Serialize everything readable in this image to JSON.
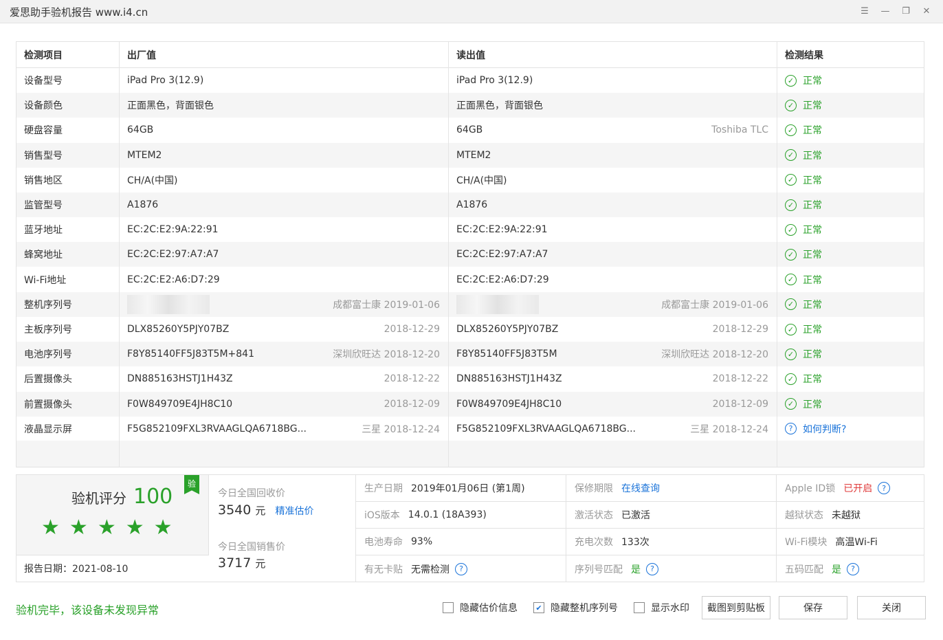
{
  "window": {
    "title": "爱思助手验机报告 www.i4.cn",
    "controls": [
      "menu-icon",
      "minimize-icon",
      "restore-icon",
      "close-icon"
    ]
  },
  "table": {
    "headers": {
      "item": "检测项目",
      "factory": "出厂值",
      "read": "读出值",
      "result": "检测结果"
    },
    "rows": [
      {
        "item": "设备型号",
        "factory": "iPad Pro 3(12.9)",
        "factory_note": "",
        "read": "iPad Pro 3(12.9)",
        "read_note": "",
        "result": "正常",
        "status": "ok"
      },
      {
        "item": "设备颜色",
        "factory": "正面黑色，背面银色",
        "factory_note": "",
        "read": "正面黑色，背面银色",
        "read_note": "",
        "result": "正常",
        "status": "ok"
      },
      {
        "item": "硬盘容量",
        "factory": "64GB",
        "factory_note": "",
        "read": "64GB",
        "read_note": "Toshiba TLC",
        "result": "正常",
        "status": "ok"
      },
      {
        "item": "销售型号",
        "factory": "MTEM2",
        "factory_note": "",
        "read": "MTEM2",
        "read_note": "",
        "result": "正常",
        "status": "ok"
      },
      {
        "item": "销售地区",
        "factory": "CH/A(中国)",
        "factory_note": "",
        "read": "CH/A(中国)",
        "read_note": "",
        "result": "正常",
        "status": "ok"
      },
      {
        "item": "监管型号",
        "factory": "A1876",
        "factory_note": "",
        "read": "A1876",
        "read_note": "",
        "result": "正常",
        "status": "ok"
      },
      {
        "item": "蓝牙地址",
        "factory": "EC:2C:E2:9A:22:91",
        "factory_note": "",
        "read": "EC:2C:E2:9A:22:91",
        "read_note": "",
        "result": "正常",
        "status": "ok"
      },
      {
        "item": "蜂窝地址",
        "factory": "EC:2C:E2:97:A7:A7",
        "factory_note": "",
        "read": "EC:2C:E2:97:A7:A7",
        "read_note": "",
        "result": "正常",
        "status": "ok"
      },
      {
        "item": "Wi-Fi地址",
        "factory": "EC:2C:E2:A6:D7:29",
        "factory_note": "",
        "read": "EC:2C:E2:A6:D7:29",
        "read_note": "",
        "result": "正常",
        "status": "ok"
      },
      {
        "item": "整机序列号",
        "factory": "",
        "factory_note": "成都富士康 2019-01-06",
        "read": "",
        "read_note": "成都富士康 2019-01-06",
        "result": "正常",
        "status": "ok",
        "hidden": true
      },
      {
        "item": "主板序列号",
        "factory": "DLX85260Y5PJY07BZ",
        "factory_note": "2018-12-29",
        "read": "DLX85260Y5PJY07BZ",
        "read_note": "2018-12-29",
        "result": "正常",
        "status": "ok"
      },
      {
        "item": "电池序列号",
        "factory": "F8Y85140FF5J83T5M+841",
        "factory_note": "深圳欣旺达 2018-12-20",
        "read": "F8Y85140FF5J83T5M",
        "read_note": "深圳欣旺达 2018-12-20",
        "result": "正常",
        "status": "ok"
      },
      {
        "item": "后置摄像头",
        "factory": "DN885163HSTJ1H43Z",
        "factory_note": "2018-12-22",
        "read": "DN885163HSTJ1H43Z",
        "read_note": "2018-12-22",
        "result": "正常",
        "status": "ok"
      },
      {
        "item": "前置摄像头",
        "factory": "F0W849709E4JH8C10",
        "factory_note": "2018-12-09",
        "read": "F0W849709E4JH8C10",
        "read_note": "2018-12-09",
        "result": "正常",
        "status": "ok"
      },
      {
        "item": "液晶显示屏",
        "factory": "F5G852109FXL3RVAAGLQA6718BG...",
        "factory_note": "三星 2018-12-24",
        "read": "F5G852109FXL3RVAAGLQA6718BG...",
        "read_note": "三星 2018-12-24",
        "result": "如何判断?",
        "status": "hint"
      }
    ]
  },
  "summary": {
    "score_label": "验机评分",
    "score": "100",
    "badge": "验",
    "stars": 5,
    "report_date": "报告日期：2021-08-10",
    "recycle_label": "今日全国回收价",
    "recycle_price": "3540",
    "recycle_unit": "元",
    "recycle_link": "精准估价",
    "sale_label": "今日全国销售价",
    "sale_price": "3717",
    "sale_unit": "元",
    "grid": {
      "prod_date_k": "生产日期",
      "prod_date_v": "2019年01月06日 (第1周)",
      "warranty_k": "保修期限",
      "warranty_v": "在线查询",
      "appleid_k": "Apple ID锁",
      "appleid_v": "已开启",
      "ios_k": "iOS版本",
      "ios_v": "14.0.1 (18A393)",
      "activation_k": "激活状态",
      "activation_v": "已激活",
      "jailbreak_k": "越狱状态",
      "jailbreak_v": "未越狱",
      "battery_k": "电池寿命",
      "battery_v": "93%",
      "charge_k": "充电次数",
      "charge_v": "133次",
      "wifi_k": "Wi-Fi模块",
      "wifi_v": "高温Wi-Fi",
      "sticker_k": "有无卡贴",
      "sticker_v": "无需检测",
      "serial_match_k": "序列号匹配",
      "serial_match_v": "是",
      "five_code_k": "五码匹配",
      "five_code_v": "是"
    }
  },
  "footer": {
    "message": "验机完毕，该设备未发现异常",
    "hide_price": {
      "label": "隐藏估价信息",
      "checked": false
    },
    "hide_serial": {
      "label": "隐藏整机序列号",
      "checked": true
    },
    "watermark": {
      "label": "显示水印",
      "checked": false
    },
    "screenshot_btn": "截图到剪贴板",
    "save_btn": "保存",
    "close_btn": "关闭"
  },
  "colors": {
    "green": "#2aa12a",
    "blue": "#1a73d9",
    "red": "#e03b3b",
    "gray_text": "#999999",
    "alt_row": "#f5f5f5"
  }
}
